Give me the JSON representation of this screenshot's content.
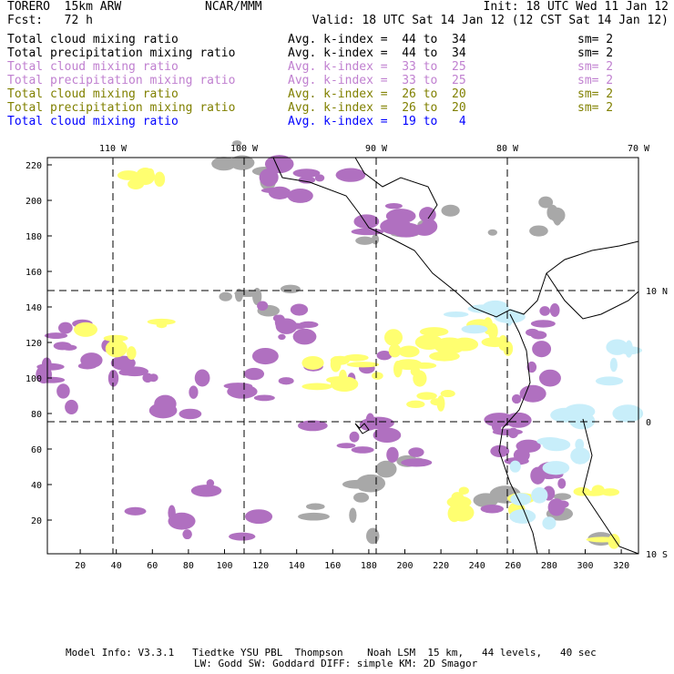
{
  "header": {
    "model": "TORERO  15km ARW",
    "org": "NCAR/MMM",
    "init": "Init: 18 UTC Wed 11 Jan 12",
    "fcst": "Fcst:   72 h",
    "valid": "Valid: 18 UTC Sat 14 Jan 12 (12 CST Sat 14 Jan 12)"
  },
  "legend": [
    {
      "field": "Total cloud mixing ratio",
      "range": "Avg. k-index =  44 to  34",
      "sm": "sm= 2",
      "color": "#000000"
    },
    {
      "field": "Total precipitation mixing ratio",
      "range": "Avg. k-index =  44 to  34",
      "sm": "sm= 2",
      "color": "#000000"
    },
    {
      "field": "Total cloud mixing ratio",
      "range": "Avg. k-index =  33 to  25",
      "sm": "sm= 2",
      "color": "#c080d0"
    },
    {
      "field": "Total precipitation mixing ratio",
      "range": "Avg. k-index =  33 to  25",
      "sm": "sm= 2",
      "color": "#c080d0"
    },
    {
      "field": "Total cloud mixing ratio",
      "range": "Avg. k-index =  26 to  20",
      "sm": "sm= 2",
      "color": "#808000"
    },
    {
      "field": "Total precipitation mixing ratio",
      "range": "Avg. k-index =  26 to  20",
      "sm": "sm= 2",
      "color": "#808000"
    },
    {
      "field": "Total cloud mixing ratio",
      "range": "Avg. k-index =  19 to   4",
      "sm": "",
      "color": "#0000ff"
    }
  ],
  "map": {
    "lon_labels": [
      "110 W",
      "100 W",
      "90 W",
      "80 W",
      "70 W"
    ],
    "lat_labels": [
      "10 N",
      "0",
      "10 S"
    ],
    "x_ticks": [
      "20",
      "40",
      "60",
      "80",
      "100",
      "120",
      "140",
      "160",
      "180",
      "200",
      "220",
      "240",
      "260",
      "280",
      "300",
      "320"
    ],
    "y_ticks": [
      "20",
      "40",
      "60",
      "80",
      "100",
      "120",
      "140",
      "160",
      "180",
      "200",
      "220"
    ],
    "colors": {
      "purple": "#b070c0",
      "yellow": "#ffff70",
      "gray": "#a8a8a8",
      "lightblue": "#c8eefa"
    }
  },
  "footer": {
    "line1": "Model Info: V3.3.1   Tiedtke YSU PBL  Thompson    Noah LSM  15 km,   44 levels,   40 sec",
    "line2": "LW: Godd SW: Goddard DIFF: simple KM: 2D Smagor"
  }
}
